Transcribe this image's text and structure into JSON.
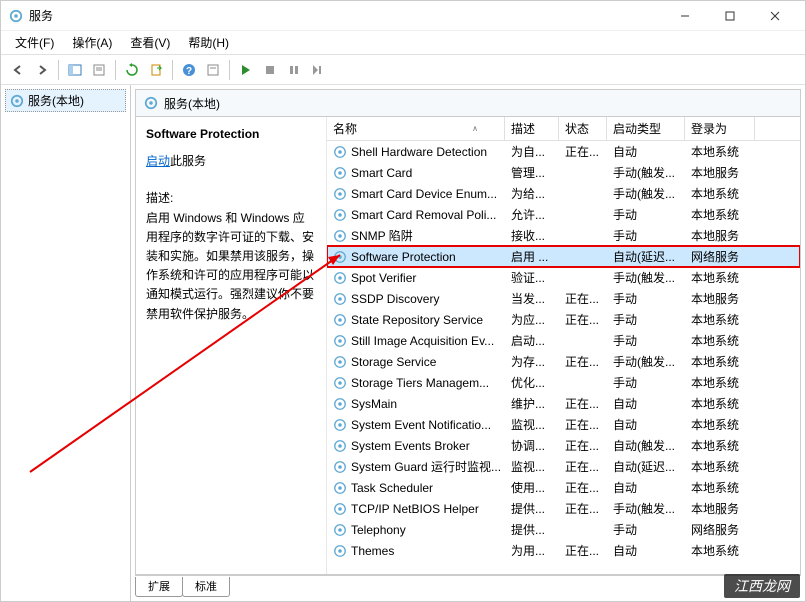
{
  "window": {
    "title": "服务"
  },
  "menu": {
    "file": "文件(F)",
    "action": "操作(A)",
    "view": "查看(V)",
    "help": "帮助(H)"
  },
  "tree": {
    "root": "服务(本地)"
  },
  "rightHeader": "服务(本地)",
  "detail": {
    "title": "Software Protection",
    "startLink": "启动",
    "startSuffix": "此服务",
    "descLabel": "描述:",
    "descText": "启用 Windows 和 Windows 应用程序的数字许可证的下载、安装和实施。如果禁用该服务，操作系统和许可的应用程序可能以通知模式运行。强烈建议你不要禁用软件保护服务。"
  },
  "columns": {
    "name": "名称",
    "desc": "描述",
    "status": "状态",
    "startup": "启动类型",
    "logon": "登录为"
  },
  "rows": [
    {
      "name": "Shell Hardware Detection",
      "desc": "为自...",
      "status": "正在...",
      "startup": "自动",
      "logon": "本地系统"
    },
    {
      "name": "Smart Card",
      "desc": "管理...",
      "status": "",
      "startup": "手动(触发...",
      "logon": "本地服务"
    },
    {
      "name": "Smart Card Device Enum...",
      "desc": "为给...",
      "status": "",
      "startup": "手动(触发...",
      "logon": "本地系统"
    },
    {
      "name": "Smart Card Removal Poli...",
      "desc": "允许...",
      "status": "",
      "startup": "手动",
      "logon": "本地系统"
    },
    {
      "name": "SNMP 陷阱",
      "desc": "接收...",
      "status": "",
      "startup": "手动",
      "logon": "本地服务"
    },
    {
      "name": "Software Protection",
      "desc": "启用 ...",
      "status": "",
      "startup": "自动(延迟...",
      "logon": "网络服务"
    },
    {
      "name": "Spot Verifier",
      "desc": "验证...",
      "status": "",
      "startup": "手动(触发...",
      "logon": "本地系统"
    },
    {
      "name": "SSDP Discovery",
      "desc": "当发...",
      "status": "正在...",
      "startup": "手动",
      "logon": "本地服务"
    },
    {
      "name": "State Repository Service",
      "desc": "为应...",
      "status": "正在...",
      "startup": "手动",
      "logon": "本地系统"
    },
    {
      "name": "Still Image Acquisition Ev...",
      "desc": "启动...",
      "status": "",
      "startup": "手动",
      "logon": "本地系统"
    },
    {
      "name": "Storage Service",
      "desc": "为存...",
      "status": "正在...",
      "startup": "手动(触发...",
      "logon": "本地系统"
    },
    {
      "name": "Storage Tiers Managem...",
      "desc": "优化...",
      "status": "",
      "startup": "手动",
      "logon": "本地系统"
    },
    {
      "name": "SysMain",
      "desc": "维护...",
      "status": "正在...",
      "startup": "自动",
      "logon": "本地系统"
    },
    {
      "name": "System Event Notificatio...",
      "desc": "监视...",
      "status": "正在...",
      "startup": "自动",
      "logon": "本地系统"
    },
    {
      "name": "System Events Broker",
      "desc": "协调...",
      "status": "正在...",
      "startup": "自动(触发...",
      "logon": "本地系统"
    },
    {
      "name": "System Guard 运行时监视...",
      "desc": "监视...",
      "status": "正在...",
      "startup": "自动(延迟...",
      "logon": "本地系统"
    },
    {
      "name": "Task Scheduler",
      "desc": "使用...",
      "status": "正在...",
      "startup": "自动",
      "logon": "本地系统"
    },
    {
      "name": "TCP/IP NetBIOS Helper",
      "desc": "提供...",
      "status": "正在...",
      "startup": "手动(触发...",
      "logon": "本地服务"
    },
    {
      "name": "Telephony",
      "desc": "提供...",
      "status": "",
      "startup": "手动",
      "logon": "网络服务"
    },
    {
      "name": "Themes",
      "desc": "为用...",
      "status": "正在...",
      "startup": "自动",
      "logon": "本地系统"
    }
  ],
  "tabs": {
    "extended": "扩展",
    "standard": "标准"
  },
  "watermark": "江西龙网"
}
